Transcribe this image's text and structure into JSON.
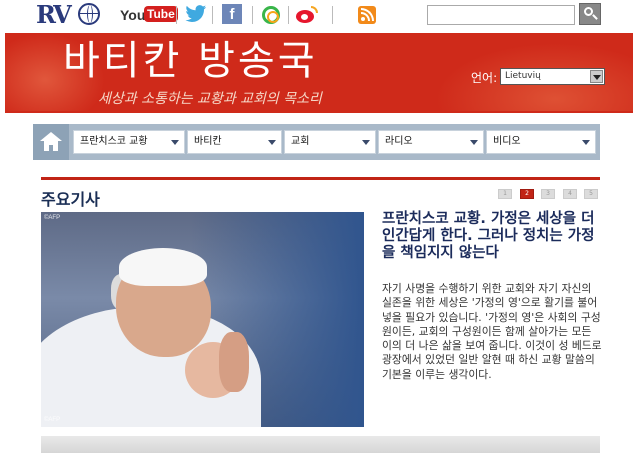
{
  "header": {
    "logo_text": "RV",
    "social": [
      {
        "name": "youtube",
        "you": "You",
        "tube": "Tube"
      },
      {
        "name": "twitter"
      },
      {
        "name": "facebook",
        "glyph": "f"
      },
      {
        "name": "google-plus"
      },
      {
        "name": "weibo"
      },
      {
        "name": "rss"
      }
    ],
    "search": {
      "placeholder": "",
      "value": ""
    }
  },
  "banner": {
    "title": "바티칸 방송국",
    "subtitle": "세상과 소통하는 교황과 교회의 목소리",
    "language_label": "언어:",
    "language_selected": "Lietuvių"
  },
  "nav": {
    "items": [
      {
        "label": "프란치스코 교황"
      },
      {
        "label": "바티칸"
      },
      {
        "label": "교회"
      },
      {
        "label": "라디오"
      },
      {
        "label": "비디오"
      }
    ]
  },
  "main": {
    "section_title": "주요기사",
    "pager": [
      "1",
      "2",
      "3",
      "4",
      "5"
    ],
    "pager_active": 2,
    "photo_credit_top": "©AFP",
    "photo_credit_bottom": "©AFP",
    "headline": "프란치스코 교황. 가정은 세상을 더 인간답게 한다. 그러나 정치는 가정을 책임지지 않는다",
    "body": "자기 사명을 수행하기 위한 교회와 자기 자신의 실존을 위한 세상은 '가정의 영'으로 활기를 불어넣을 필요가 있습니다. '가정의 영'은 사회의 구성원이든, 교회의 구성원이든 함께 살아가는 모든 이의 더 나은 삶을 보여 줍니다. 이것이 성 베드로 광장에서 있었던 일반 알현 때 하신 교황 말씀의 기본을 이루는 생각이다."
  },
  "colors": {
    "brand_red": "#cf2a1a",
    "nav_blue_gray": "#a9b9c9",
    "headline_navy": "#1b2b5b"
  }
}
